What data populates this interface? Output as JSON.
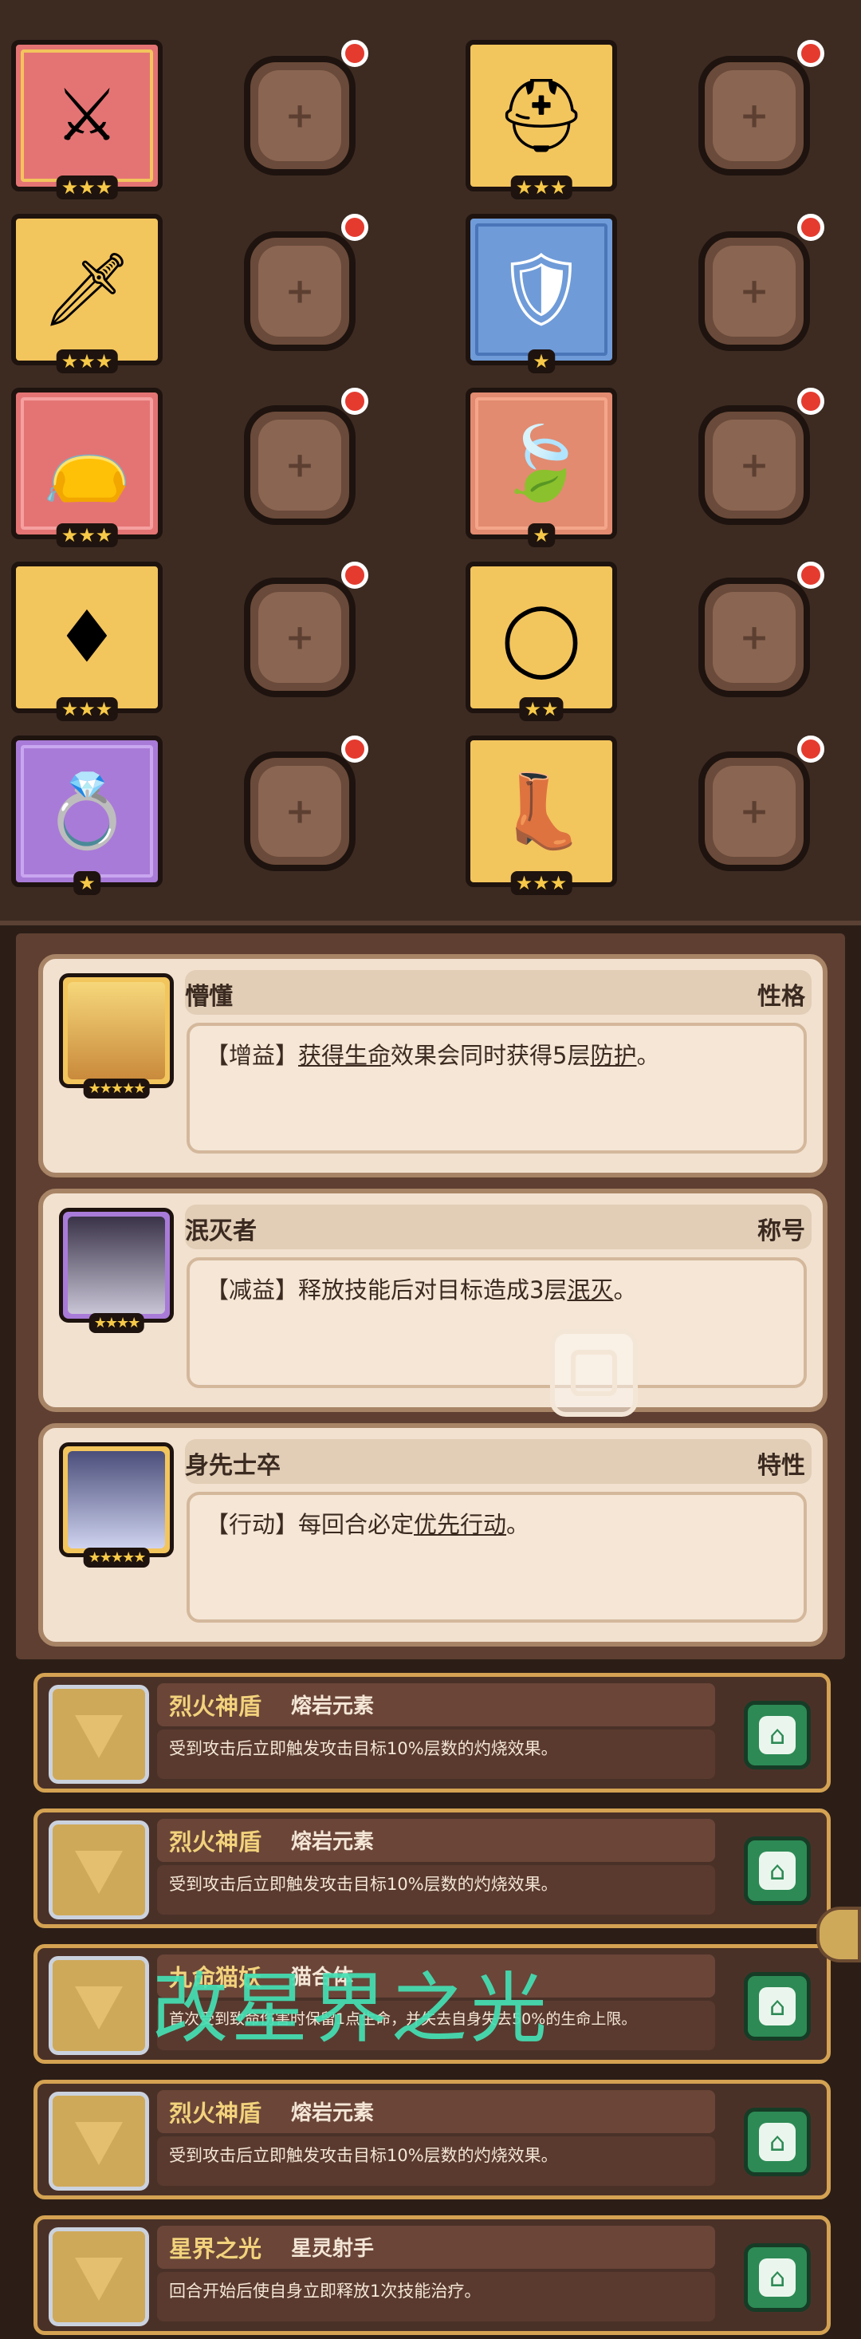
{
  "equipment": {
    "items": [
      {
        "name": "crossed-swords",
        "color": "#e47474",
        "stars": "★★★"
      },
      {
        "name": "horned-helmet",
        "color": "#f3c55d",
        "stars": "★★★"
      },
      {
        "name": "dagger",
        "color": "#f3c55d",
        "stars": "★★★"
      },
      {
        "name": "white-armor",
        "color": "#6f9bd8",
        "stars": "★"
      },
      {
        "name": "pouch",
        "color": "#e47474",
        "stars": "★★★"
      },
      {
        "name": "green-leaf",
        "color": "#e28b70",
        "stars": "★"
      },
      {
        "name": "red-gem",
        "color": "#f3c55d",
        "stars": "★★★"
      },
      {
        "name": "ring-bracelet",
        "color": "#f3c55d",
        "stars": "★★"
      },
      {
        "name": "green-ring",
        "color": "#a97bd8",
        "stars": "★"
      },
      {
        "name": "boots",
        "color": "#f3c55d",
        "stars": "★★★"
      }
    ]
  },
  "traits": [
    {
      "name": "懵懂",
      "type": "性格",
      "stars": "★★★★★",
      "desc_prefix": "【增益】",
      "desc_parts": [
        "获得生命",
        "效果会同时获得5层",
        "防护",
        "。"
      ]
    },
    {
      "name": "泯灭者",
      "type": "称号",
      "stars": "★★★★",
      "desc_prefix": "【减益】",
      "desc_parts": [
        "释放技能后对目标造成3层",
        "泯灭",
        "。"
      ]
    },
    {
      "name": "身先士卒",
      "type": "特性",
      "stars": "★★★★★",
      "desc_prefix": "【行动】",
      "desc_parts": [
        "每回合必定",
        "优先行动",
        "。"
      ]
    }
  ],
  "skills": [
    {
      "name": "烈火神盾",
      "element": "熔岩元素",
      "desc": "受到攻击后立即触发攻击目标10%层数的灼烧效果。"
    },
    {
      "name": "烈火神盾",
      "element": "熔岩元素",
      "desc": "受到攻击后立即触发攻击目标10%层数的灼烧效果。"
    },
    {
      "name": "九命猫妖",
      "element": "猫合体",
      "desc": "首次受到致命伤害时保留1点生命，并失去自身失去50%的生命上限。"
    },
    {
      "name": "烈火神盾",
      "element": "熔岩元素",
      "desc": "受到攻击后立即触发攻击目标10%层数的灼烧效果。"
    },
    {
      "name": "星界之光",
      "element": "星灵射手",
      "desc": "回合开始后使自身立即释放1次技能治疗。"
    }
  ],
  "watermark": "改星界之光"
}
